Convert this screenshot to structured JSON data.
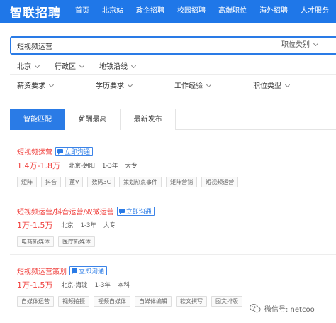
{
  "brand": {
    "logo": "智联招聘"
  },
  "nav": [
    "首页",
    "北京站",
    "政企招聘",
    "校园招聘",
    "高端职位",
    "海外招聘",
    "人才服务"
  ],
  "search": {
    "value": "短视频运营",
    "category": "职位类别"
  },
  "location": [
    "北京",
    "行政区",
    "地铁沿线"
  ],
  "filters": [
    "薪资要求",
    "学历要求",
    "工作经验",
    "职位类型"
  ],
  "tabs": [
    "智能匹配",
    "薪酬最高",
    "最新发布"
  ],
  "chat_label": "立即沟通",
  "jobs": [
    {
      "title": "短视频运营",
      "salary": "1.4万-1.8万",
      "location": "北京-朝阳",
      "experience": "1-3年",
      "education": "大专",
      "tags": [
        "短阵",
        "抖音",
        "蓝V",
        "数码3C",
        "策划热点事件",
        "矩阵营销",
        "短视频运营"
      ]
    },
    {
      "title": "短视频运营/抖音运营/双微运营",
      "salary": "1万-1.5万",
      "location": "北京",
      "experience": "1-3年",
      "education": "大专",
      "tags": [
        "电商新媒体",
        "医疗新媒体"
      ]
    },
    {
      "title": "短视频运营策划",
      "salary": "1万-1.5万",
      "location": "北京-海淀",
      "experience": "1-3年",
      "education": "本科",
      "tags": [
        "自媒体运营",
        "视频拍摄",
        "视频自媒体",
        "自媒体编辑",
        "软文撰写",
        "图文排版"
      ]
    }
  ],
  "watermark": "微信号: netcoo"
}
